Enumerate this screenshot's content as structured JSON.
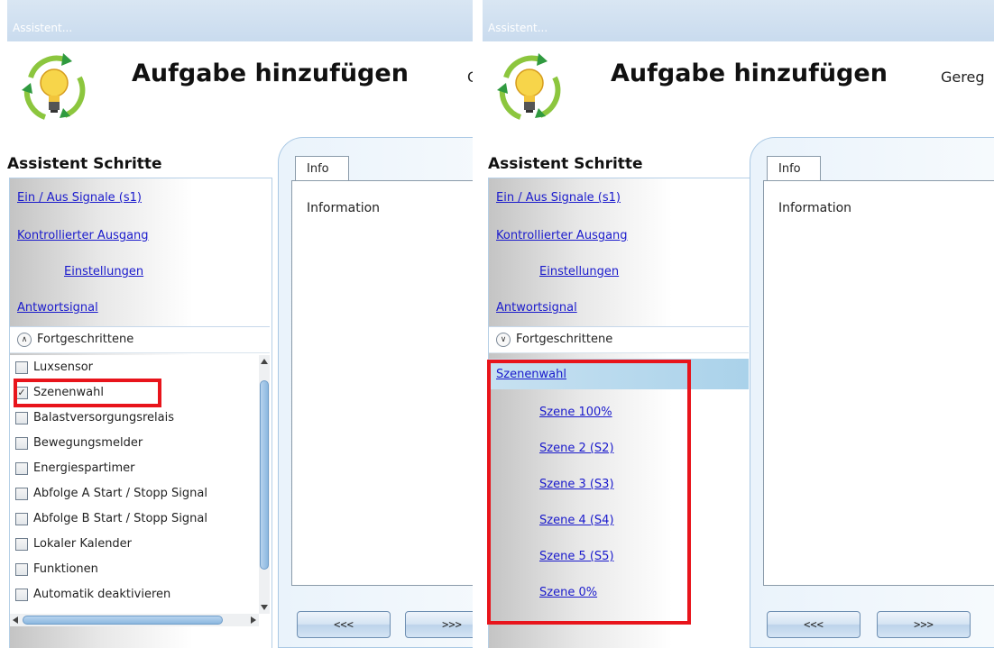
{
  "left": {
    "window_title": "Assistent...",
    "app_title": "Aufgabe hinzufügen",
    "app_subtitle": "G",
    "steps_title": "Assistent Schritte",
    "steps": [
      "Ein / Aus Signale (s1)",
      "Kontrollierter Ausgang",
      "Einstellungen",
      "Antwortsignal"
    ],
    "advanced_label": "Fortgeschrittene",
    "advanced_state": "expanded",
    "checklist": [
      {
        "label": "Luxsensor",
        "checked": false
      },
      {
        "label": "Szenenwahl",
        "checked": true
      },
      {
        "label": "Balastversorgungsrelais",
        "checked": false
      },
      {
        "label": "Bewegungsmelder",
        "checked": false
      },
      {
        "label": "Energiespartimer",
        "checked": false
      },
      {
        "label": "Abfolge A Start / Stopp Signal",
        "checked": false
      },
      {
        "label": "Abfolge B Start / Stopp Signal",
        "checked": false
      },
      {
        "label": "Lokaler Kalender",
        "checked": false
      },
      {
        "label": "Funktionen",
        "checked": false
      },
      {
        "label": "Automatik deaktivieren",
        "checked": false
      }
    ],
    "tab_label": "Info",
    "info_text": "Information",
    "back_label": "<<<",
    "next_label": ">>>"
  },
  "right": {
    "window_title": "Assistent...",
    "app_title": "Aufgabe hinzufügen",
    "app_subtitle": "Gereg",
    "steps_title": "Assistent Schritte",
    "steps": [
      "Ein / Aus Signale (s1)",
      "Kontrollierter Ausgang",
      "Einstellungen",
      "Antwortsignal"
    ],
    "advanced_label": "Fortgeschrittene",
    "advanced_state": "collapsed",
    "scene_header": "Szenenwahl",
    "scenes": [
      "Szene 100%",
      "Szene 2 (S2)",
      "Szene 3 (S3)",
      "Szene 4 (S4)",
      "Szene 5 (S5)",
      "Szene 0%"
    ],
    "tab_label": "Info",
    "info_text": "Information",
    "back_label": "<<<",
    "next_label": ">>>"
  },
  "colors": {
    "highlight": "#e8141b",
    "link": "#1a1acc",
    "frame": "#a9c8e4"
  },
  "icons": [
    "lightbulb-cycle-logo",
    "expand-arrow-icon",
    "checkbox-icon",
    "scroll-arrow-icon"
  ]
}
